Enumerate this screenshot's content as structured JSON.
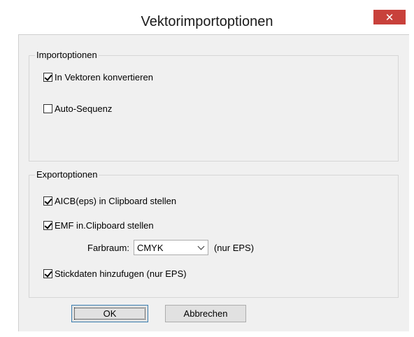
{
  "window": {
    "title": "Vektorimportoptionen",
    "close_glyph": "✕"
  },
  "import_group": {
    "legend": "Importoptionen",
    "items": [
      {
        "label": "In Vektoren konvertieren",
        "checked": true
      },
      {
        "label": "Auto-Sequenz",
        "checked": false
      }
    ]
  },
  "export_group": {
    "legend": "Exportoptionen",
    "items": [
      {
        "label": "AICB(eps) in Clipboard stellen",
        "checked": true
      },
      {
        "label": "EMF in.Clipboard stellen",
        "checked": true
      }
    ],
    "farbraum": {
      "label": "Farbraum:",
      "value": "CMYK",
      "suffix": "(nur EPS)"
    },
    "stick": {
      "label": "Stickdaten hinzufugen (nur EPS)",
      "checked": true
    }
  },
  "buttons": {
    "ok": "OK",
    "cancel": "Abbrechen"
  }
}
